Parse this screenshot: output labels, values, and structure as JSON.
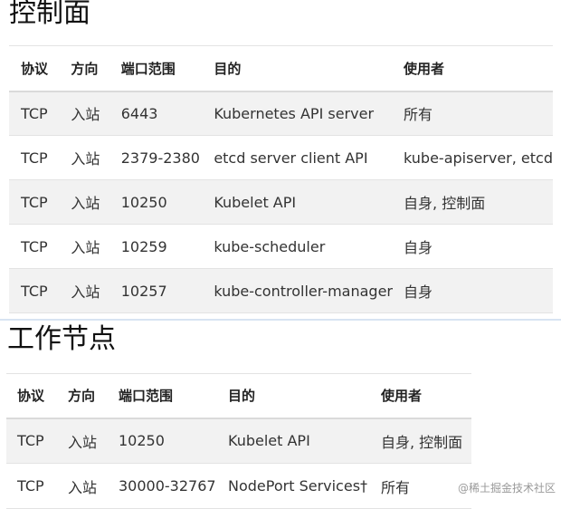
{
  "control_plane": {
    "title": "控制面",
    "headers": [
      "协议",
      "方向",
      "端口范围",
      "目的",
      "使用者"
    ],
    "rows": [
      [
        "TCP",
        "入站",
        "6443",
        "Kubernetes API server",
        "所有"
      ],
      [
        "TCP",
        "入站",
        "2379-2380",
        "etcd server client API",
        "kube-apiserver, etcd"
      ],
      [
        "TCP",
        "入站",
        "10250",
        "Kubelet API",
        "自身, 控制面"
      ],
      [
        "TCP",
        "入站",
        "10259",
        "kube-scheduler",
        "自身"
      ],
      [
        "TCP",
        "入站",
        "10257",
        "kube-controller-manager",
        "自身"
      ]
    ]
  },
  "worker_nodes": {
    "title": "工作节点",
    "headers": [
      "协议",
      "方向",
      "端口范围",
      "目的",
      "使用者"
    ],
    "rows": [
      [
        "TCP",
        "入站",
        "10250",
        "Kubelet API",
        "自身, 控制面"
      ],
      [
        "TCP",
        "入站",
        "30000-32767",
        "NodePort Services†",
        "所有"
      ]
    ]
  },
  "watermark": "@稀土掘金技术社区"
}
